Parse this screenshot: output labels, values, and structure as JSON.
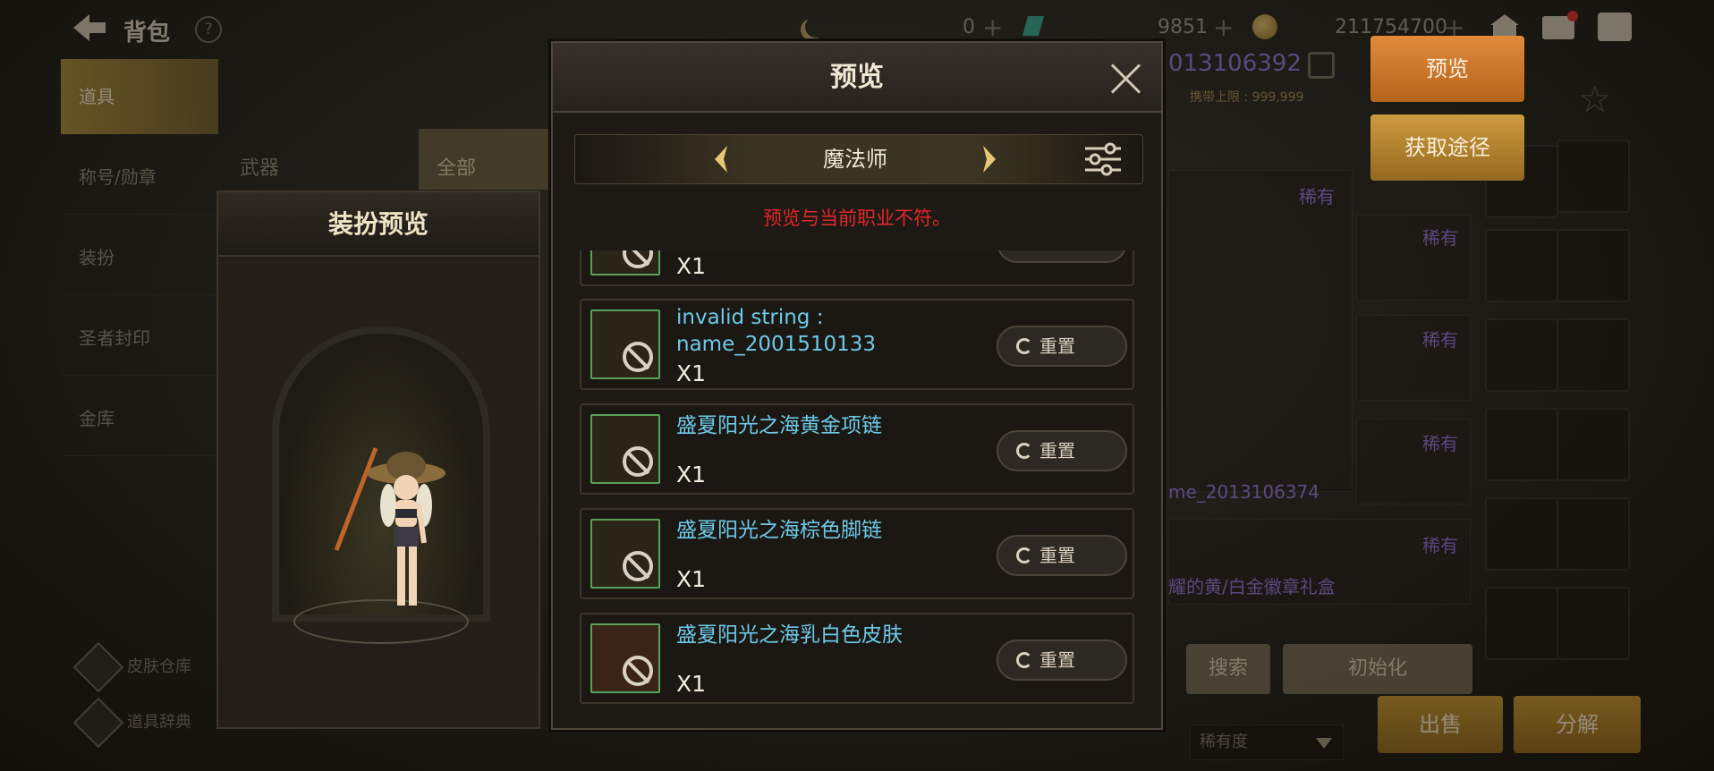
{
  "topbar": {
    "title": "背包",
    "help": "?",
    "currency_a": "0",
    "currency_b": "9851",
    "gold": "211754700",
    "plus": "+"
  },
  "left_nav": {
    "items": [
      {
        "label": "道具",
        "active": true
      },
      {
        "label": "称号/勋章"
      },
      {
        "label": "装扮"
      },
      {
        "label": "圣者封印"
      },
      {
        "label": "金库"
      }
    ],
    "bottom_links": [
      {
        "label": "皮肤仓库"
      },
      {
        "label": "道具辞典"
      }
    ]
  },
  "category_tabs": [
    {
      "label": "武器"
    },
    {
      "label": "全部",
      "active": true
    }
  ],
  "costume_preview": {
    "title": "装扮预览"
  },
  "background_right": {
    "id_text": "013106392",
    "cap_label": "携带上限 : 999,999",
    "preview_button": "预览",
    "source_button": "获取途径",
    "rare_label": "稀有",
    "name_fragment": "me_2013106374",
    "purple_item": "耀的黄/白金徽章礼盒",
    "search_button": "搜索",
    "init_button": "初始化",
    "sell_button": "出售",
    "disassemble_button": "分解",
    "rarity_select": "稀有度"
  },
  "modal": {
    "title": "预览",
    "class_name": "魔法师",
    "warning": "预览与当前职业不符。",
    "warning_color": "#e3262a",
    "reset_label": "重置",
    "items": [
      {
        "name": "",
        "qty": "X1",
        "reset": "重置"
      },
      {
        "name": "invalid string : name_2001510133",
        "qty": "X1",
        "reset": "重置"
      },
      {
        "name": "盛夏阳光之海黄金项链",
        "qty": "X1",
        "reset": "重置"
      },
      {
        "name": "盛夏阳光之海棕色脚链",
        "qty": "X1",
        "reset": "重置"
      },
      {
        "name": "盛夏阳光之海乳白色皮肤",
        "qty": "X1",
        "reset": "重置"
      }
    ]
  },
  "colors": {
    "item_name": "#6ec9e8",
    "rare_purple": "#8b6cd8",
    "accent_gold": "#a88937"
  }
}
